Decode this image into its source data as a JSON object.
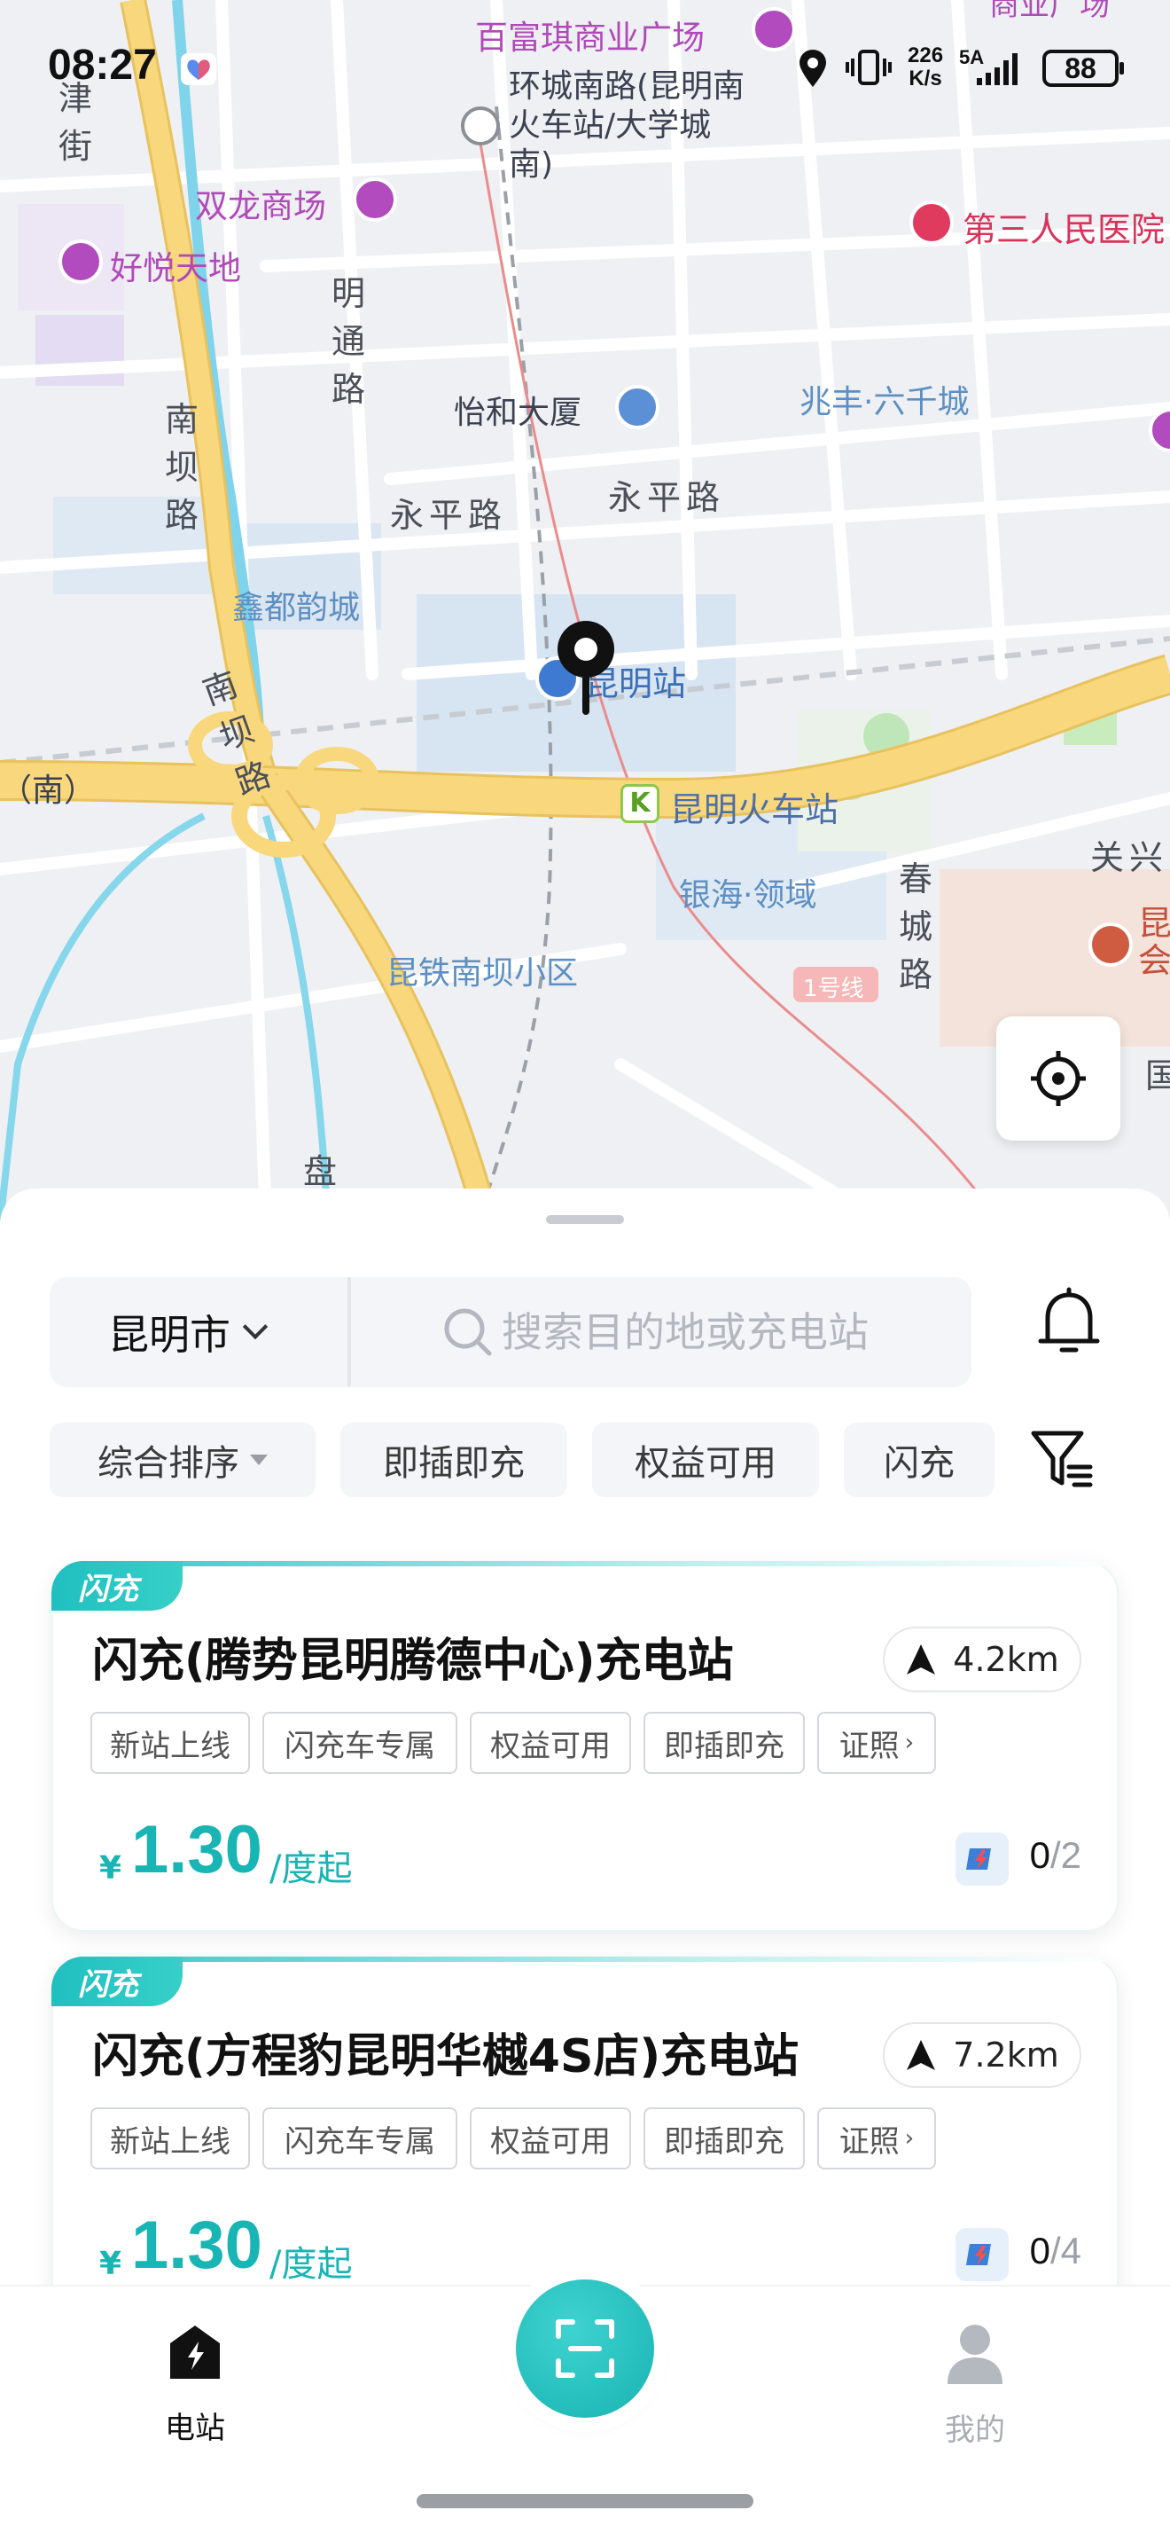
{
  "status_bar": {
    "time": "08:27",
    "net_speed_value": "226",
    "net_speed_unit": "K/s",
    "network": "5A",
    "battery": "88"
  },
  "map": {
    "labels": {
      "fuyuqi_plaza": "百富琪商业广场",
      "huancheng_south_road": "环城南路(昆明南火车站/大学城南)",
      "shuanglong_mall": "双龙商场",
      "haoyue_tiandi": "好悦天地",
      "jin_street": "津街",
      "mingtong_road": "明通路",
      "third_hospital": "第三人民医院",
      "yihe_building": "怡和大厦",
      "zhaofeng_liuqiancheng": "兆丰·六千城",
      "nanba_road_1": "南坝路",
      "yongping_road_1": "永平路",
      "yongping_road_2": "永平路",
      "xindu_yuncheng": "鑫都韵城",
      "kunming_station": "昆明站",
      "nanba_road_2": "南坝路",
      "south_fragment": "（南）",
      "kunming_railway_station": "昆明火车站",
      "yinhai_lingyu": "银海·领域",
      "chuncheng_road": "春城路",
      "guanxing": "关兴",
      "kunming_fragment": "昆会",
      "line1": "1号线",
      "kuntie_nanba": "昆铁南坝小区",
      "pan_fragment": "盘",
      "guo_fragment": "国",
      "top_right_fragment": "商业广场"
    },
    "icons": [
      "location-pin-icon",
      "locate-icon"
    ]
  },
  "search": {
    "city": "昆明市",
    "placeholder": "搜索目的地或充电站"
  },
  "filters": [
    {
      "label": "综合排序"
    },
    {
      "label": "即插即充"
    },
    {
      "label": "权益可用"
    },
    {
      "label": "闪充"
    }
  ],
  "stations": [
    {
      "badge": "闪充",
      "name": "闪充(腾势昆明腾德中心)充电站",
      "distance": "4.2km",
      "tags": [
        "新站上线",
        "闪充车专属",
        "权益可用",
        "即插即充",
        "证照"
      ],
      "price_symbol": "¥",
      "price": "1.30",
      "price_unit": "/度起",
      "available": "0",
      "total": "/2"
    },
    {
      "badge": "闪充",
      "name": "闪充(方程豹昆明华樾4S店)充电站",
      "distance": "7.2km",
      "tags": [
        "新站上线",
        "闪充车专属",
        "权益可用",
        "即插即充",
        "证照"
      ],
      "price_symbol": "¥",
      "price": "1.30",
      "price_unit": "/度起",
      "available": "0",
      "total": "/4"
    }
  ],
  "nav": {
    "stations_label": "电站",
    "mine_label": "我的",
    "active_color": "#111111",
    "inactive_color": "#a9adb4"
  },
  "colors": {
    "accent": "#19b4b4",
    "map_road_major": "#f6d37a",
    "map_water": "#7fd3ea"
  }
}
